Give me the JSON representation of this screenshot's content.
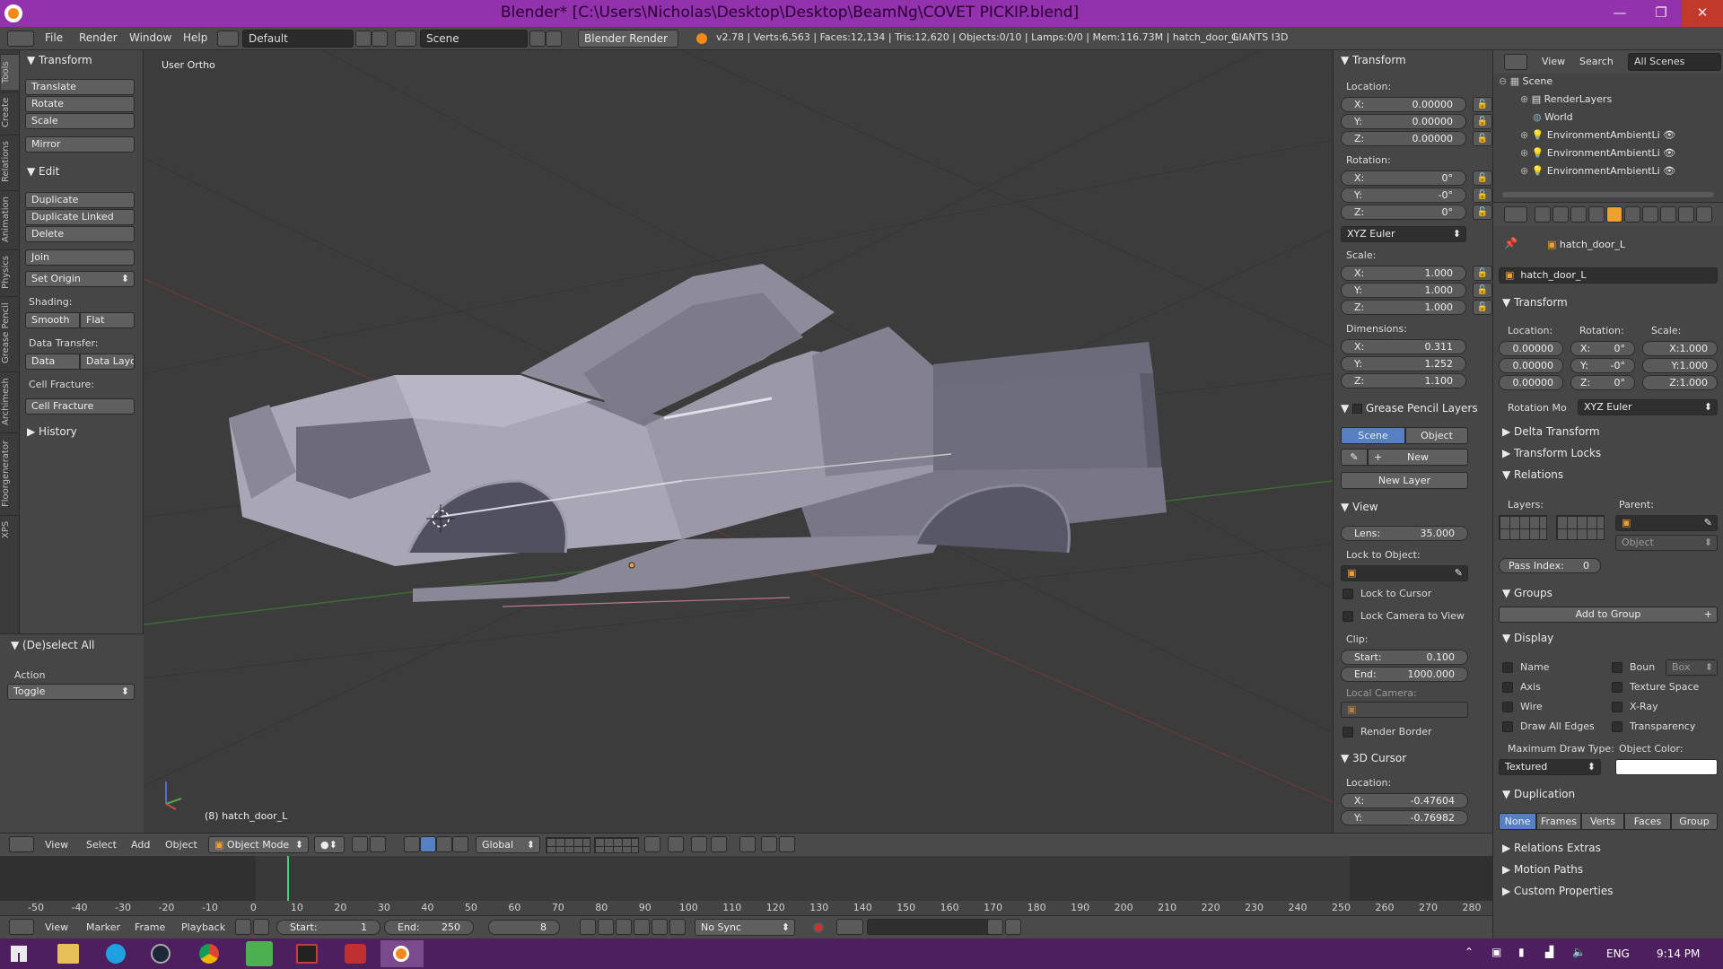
{
  "window": {
    "title": "Blender* [C:\\Users\\Nicholas\\Desktop\\Desktop\\BeamNg\\COVET PICKIP.blend]",
    "min": "—",
    "max": "❐",
    "close": "✕"
  },
  "menu": [
    "File",
    "Render",
    "Window",
    "Help"
  ],
  "screen_layout": "Default",
  "scene_name": "Scene",
  "render_engine": "Blender Render",
  "stats": "v2.78 | Verts:6,563 | Faces:12,134 | Tris:12,620 | Objects:0/10 | Lamps:0/0 | Mem:116.73M | hatch_door_L",
  "addon_label": "GIANTS I3D",
  "left_tabs": [
    "Tools",
    "Create",
    "Relations",
    "Animation",
    "Physics",
    "Grease Pencil",
    "Archimesh",
    "Floorgenerator",
    "XPS"
  ],
  "toolshelf": {
    "transform_header": "Transform",
    "translate": "Translate",
    "rotate": "Rotate",
    "scale": "Scale",
    "mirror": "Mirror",
    "edit_header": "Edit",
    "duplicate": "Duplicate",
    "duplicate_linked": "Duplicate Linked",
    "delete": "Delete",
    "join": "Join",
    "set_origin": "Set Origin",
    "shading_label": "Shading:",
    "smooth": "Smooth",
    "flat": "Flat",
    "data_transfer_label": "Data Transfer:",
    "data": "Data",
    "data_layo": "Data Layo",
    "cell_fracture_label": "Cell Fracture:",
    "cell_fracture": "Cell Fracture",
    "history_header": "History",
    "deselect_header": "(De)select All",
    "action_label": "Action",
    "action_value": "Toggle"
  },
  "viewport": {
    "view_name": "User Ortho",
    "object_label": "(8) hatch_door_L"
  },
  "nprop": {
    "transform_header": "Transform",
    "location_label": "Location:",
    "location": [
      {
        "a": "X:",
        "v": "0.00000"
      },
      {
        "a": "Y:",
        "v": "0.00000"
      },
      {
        "a": "Z:",
        "v": "0.00000"
      }
    ],
    "rotation_label": "Rotation:",
    "rotation": [
      {
        "a": "X:",
        "v": "0°"
      },
      {
        "a": "Y:",
        "v": "-0°"
      },
      {
        "a": "Z:",
        "v": "0°"
      }
    ],
    "rotation_mode": "XYZ Euler",
    "scale_label": "Scale:",
    "scale": [
      {
        "a": "X:",
        "v": "1.000"
      },
      {
        "a": "Y:",
        "v": "1.000"
      },
      {
        "a": "Z:",
        "v": "1.000"
      }
    ],
    "dimensions_label": "Dimensions:",
    "dimensions": [
      {
        "a": "X:",
        "v": "0.311"
      },
      {
        "a": "Y:",
        "v": "1.252"
      },
      {
        "a": "Z:",
        "v": "1.100"
      }
    ],
    "gp_header": "Grease Pencil Layers",
    "gp_scene": "Scene",
    "gp_object": "Object",
    "gp_new": "New",
    "gp_new_layer": "New Layer",
    "view_header": "View",
    "lens_label": "Lens:",
    "lens_value": "35.000",
    "lock_to_object": "Lock to Object:",
    "lock_to_cursor": "Lock to Cursor",
    "lock_camera": "Lock Camera to View",
    "clip_label": "Clip:",
    "clip_start_label": "Start:",
    "clip_start": "0.100",
    "clip_end_label": "End:",
    "clip_end": "1000.000",
    "local_camera": "Local Camera:",
    "render_border": "Render Border",
    "cursor_header": "3D Cursor",
    "cursor_location_label": "Location:",
    "cursor": [
      {
        "a": "X:",
        "v": "-0.47604"
      },
      {
        "a": "Y:",
        "v": "-0.76982"
      }
    ]
  },
  "outliner": {
    "view": "View",
    "search": "Search",
    "filter": "All Scenes",
    "rows": [
      "Scene",
      "RenderLayers",
      "World",
      "EnvironmentAmbientLi",
      "EnvironmentAmbientLi",
      "EnvironmentAmbientLi"
    ]
  },
  "props": {
    "object_breadcrumb": "hatch_door_L",
    "object_name": "hatch_door_L",
    "transform_header": "Transform",
    "location_label": "Location:",
    "rotation_label": "Rotation:",
    "scale_label": "Scale:",
    "loc": [
      "0.00000",
      "0.00000",
      "0.00000"
    ],
    "rot": [
      {
        "a": "X:",
        "v": "0°"
      },
      {
        "a": "Y:",
        "v": "-0°"
      },
      {
        "a": "Z:",
        "v": "0°"
      }
    ],
    "scl": [
      "X:1.000",
      "Y:1.000",
      "Z:1.000"
    ],
    "rotation_mode_label": "Rotation Mo",
    "rotation_mode": "XYZ Euler",
    "delta_transform": "Delta Transform",
    "transform_locks": "Transform Locks",
    "relations": "Relations",
    "layers_label": "Layers:",
    "parent_label": "Parent:",
    "parent_type": "Object",
    "pass_index_label": "Pass Index:",
    "pass_index": "0",
    "groups": "Groups",
    "add_to_group": "Add to Group",
    "display": "Display",
    "name": "Name",
    "bounds": "Boun",
    "bounds_type": "Box",
    "axis": "Axis",
    "texture_space": "Texture Space",
    "wire": "Wire",
    "xray": "X-Ray",
    "draw_all_edges": "Draw All Edges",
    "transparency": "Transparency",
    "max_draw_type_label": "Maximum Draw Type:",
    "max_draw_type": "Textured",
    "object_color_label": "Object Color:",
    "duplication": "Duplication",
    "dup_options": [
      "None",
      "Frames",
      "Verts",
      "Faces",
      "Group"
    ],
    "relations_extras": "Relations Extras",
    "motion_paths": "Motion Paths",
    "custom_properties": "Custom Properties"
  },
  "view_header": {
    "view": "View",
    "select": "Select",
    "add": "Add",
    "object": "Object",
    "mode": "Object Mode",
    "orientation": "Global"
  },
  "timeline": {
    "ticks": [
      "-50",
      "-40",
      "-30",
      "-20",
      "-10",
      "0",
      "10",
      "20",
      "30",
      "40",
      "50",
      "60",
      "70",
      "80",
      "90",
      "100",
      "110",
      "120",
      "130",
      "140",
      "150",
      "160",
      "170",
      "180",
      "190",
      "200",
      "210",
      "220",
      "230",
      "240",
      "250",
      "260",
      "270",
      "280"
    ],
    "view": "View",
    "marker": "Marker",
    "frame": "Frame",
    "playback": "Playback",
    "start_label": "Start:",
    "start": "1",
    "end_label": "End:",
    "end": "250",
    "current": "8",
    "sync": "No Sync"
  },
  "taskbar": {
    "lang": "ENG",
    "time": "9:14 PM"
  }
}
